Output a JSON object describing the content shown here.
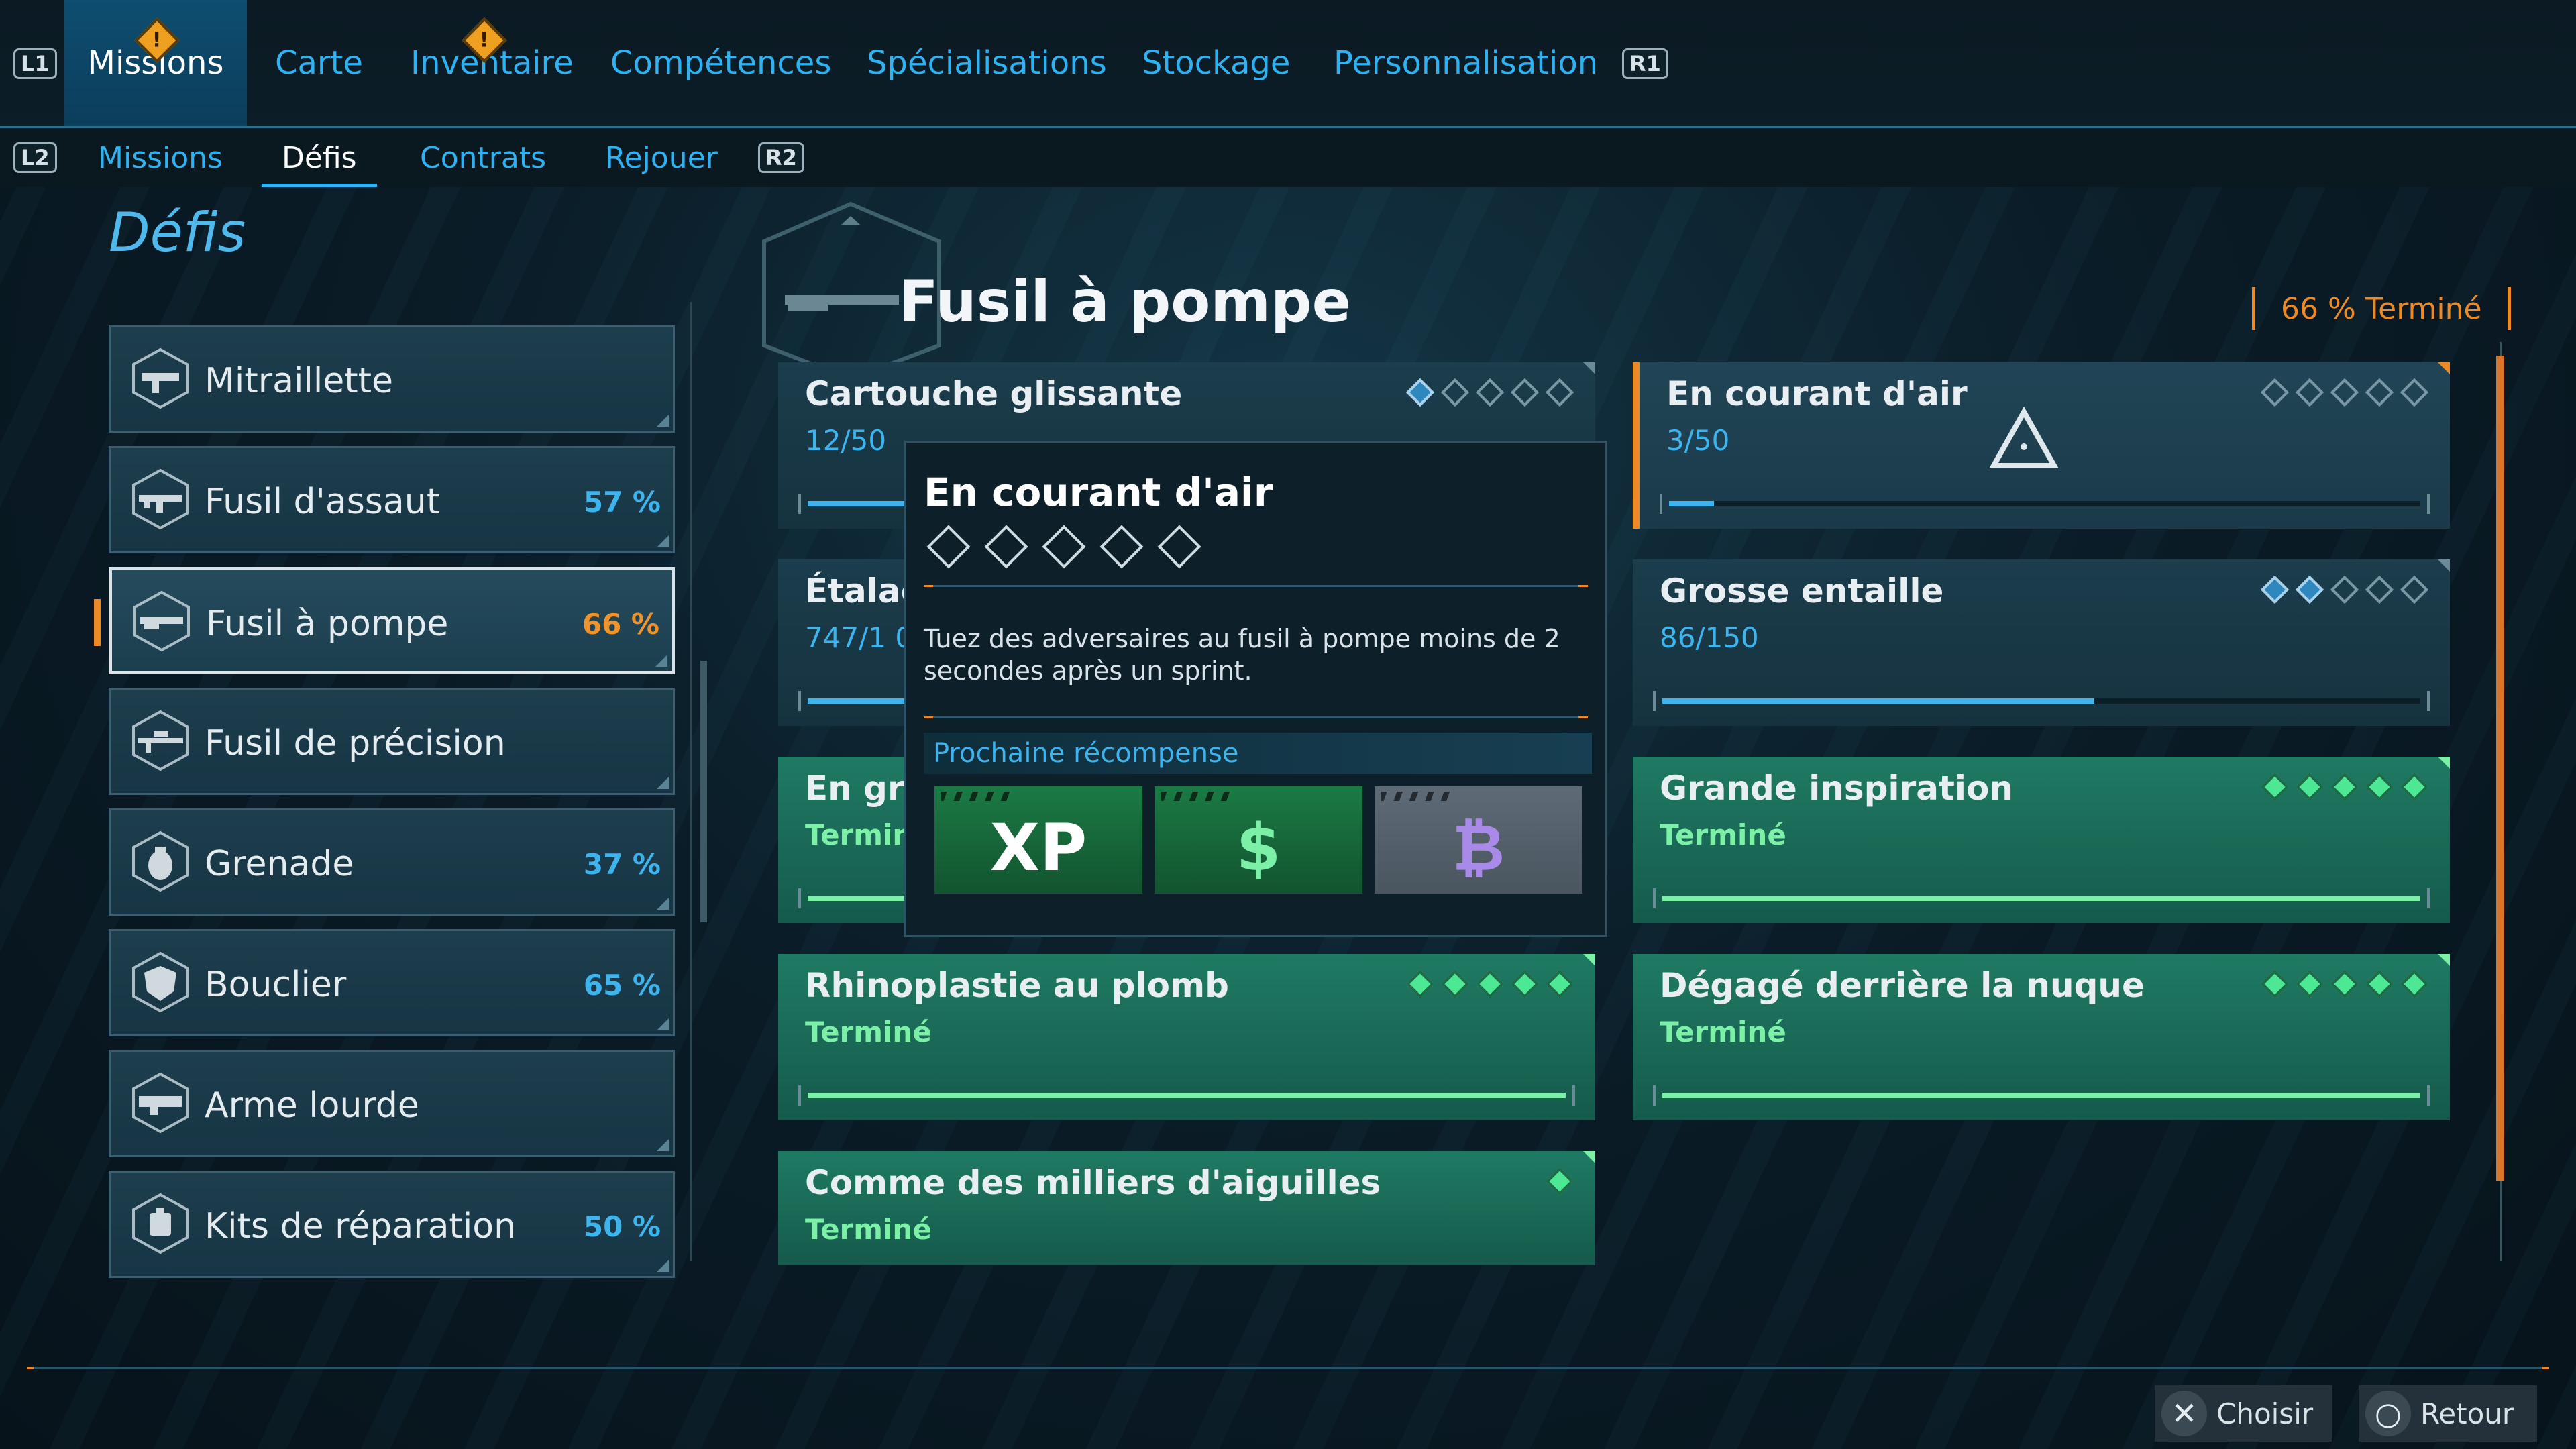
{
  "top_nav": {
    "left_button": "L1",
    "right_button": "R1",
    "tabs": [
      "Missions",
      "Carte",
      "Inventaire",
      "Compétences",
      "Spécialisations",
      "Stockage",
      "Personnalisation"
    ],
    "alert_icon": "!"
  },
  "sub_nav": {
    "left_button": "L2",
    "right_button": "R2",
    "tabs": [
      "Missions",
      "Défis",
      "Contrats",
      "Rejouer"
    ]
  },
  "section_title": "Défis",
  "categories": [
    {
      "name": "Mitraillette",
      "pct": "",
      "icon": "smg-icon"
    },
    {
      "name": "Fusil d'assaut",
      "pct": "57 %",
      "icon": "assault-rifle-icon"
    },
    {
      "name": "Fusil à pompe",
      "pct": "66 %",
      "icon": "shotgun-icon",
      "selected": true
    },
    {
      "name": "Fusil de précision",
      "pct": "",
      "icon": "sniper-icon"
    },
    {
      "name": "Grenade",
      "pct": "37 %",
      "icon": "grenade-icon"
    },
    {
      "name": "Bouclier",
      "pct": "65 %",
      "icon": "shield-icon"
    },
    {
      "name": "Arme lourde",
      "pct": "",
      "icon": "heavy-weapon-icon"
    },
    {
      "name": "Kits de réparation",
      "pct": "50 %",
      "icon": "repair-kit-icon"
    }
  ],
  "main": {
    "title": "Fusil à pompe",
    "completion": "66 % Terminé"
  },
  "challenges": [
    {
      "title": "Cartouche glissante",
      "status": "12/50",
      "progress": 0.24,
      "tiers_filled": 1,
      "done": false
    },
    {
      "title": "En courant d'air",
      "status": "3/50",
      "progress": 0.06,
      "tiers_filled": 0,
      "done": false,
      "highlighted": true
    },
    {
      "title": "Étalag",
      "status": "747/1 0",
      "progress": 0.6,
      "tiers_filled": 0,
      "done": false
    },
    {
      "title": "Grosse entaille",
      "status": "86/150",
      "progress": 0.57,
      "tiers_filled": 2,
      "done": false
    },
    {
      "title": "En gra",
      "status": "Termine",
      "progress": 1,
      "tiers_filled": 5,
      "done": true
    },
    {
      "title": "Grande inspiration",
      "status": "Terminé",
      "progress": 1,
      "tiers_filled": 5,
      "done": true
    },
    {
      "title": "Rhinoplastie au plomb",
      "status": "Terminé",
      "progress": 1,
      "tiers_filled": 5,
      "done": true
    },
    {
      "title": "Dégagé derrière la nuque",
      "status": "Terminé",
      "progress": 1,
      "tiers_filled": 5,
      "done": true
    },
    {
      "title": "Comme des milliers d'aiguilles",
      "status": "Terminé",
      "progress": 1,
      "tiers_filled": 1,
      "tiers_total": 1,
      "done": true
    }
  ],
  "tooltip": {
    "title": "En courant d'air",
    "description": "Tuez des adversaires au fusil à pompe moins de 2 secondes après un sprint.",
    "reward_label": "Prochaine récompense",
    "rewards": [
      {
        "type": "xp",
        "glyph": "XP",
        "color": "#1b7a44"
      },
      {
        "type": "cash",
        "glyph": "$",
        "color": "#1b7a44"
      },
      {
        "type": "token",
        "glyph": "₿",
        "color": "#5e6a75"
      }
    ]
  },
  "prompts": [
    {
      "symbol": "✕",
      "label": "Choisir"
    },
    {
      "symbol": "○",
      "label": "Retour"
    }
  ],
  "colors": {
    "accent_blue": "#2fb2f2",
    "accent_orange": "#ee8a25",
    "done_green": "#7cf0a6"
  }
}
